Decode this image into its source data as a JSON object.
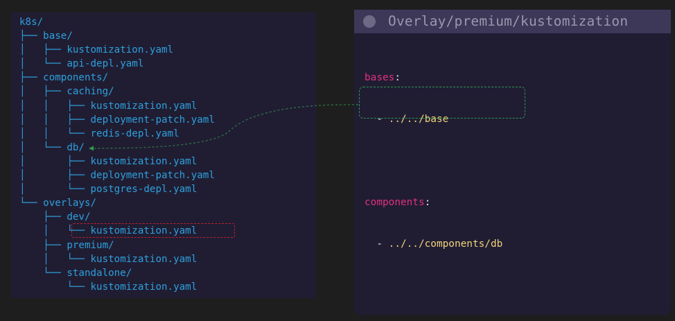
{
  "tree": {
    "rows": [
      {
        "prefix": "",
        "name": "k8s/"
      },
      {
        "prefix": "├── ",
        "name": "base/"
      },
      {
        "prefix": "│   ├── ",
        "name": "kustomization.yaml"
      },
      {
        "prefix": "│   └── ",
        "name": "api-depl.yaml"
      },
      {
        "prefix": "├── ",
        "name": "components/"
      },
      {
        "prefix": "│   ├── ",
        "name": "caching/"
      },
      {
        "prefix": "│   │   ├── ",
        "name": "kustomization.yaml"
      },
      {
        "prefix": "│   │   ├── ",
        "name": "deployment-patch.yaml"
      },
      {
        "prefix": "│   │   └── ",
        "name": "redis-depl.yaml"
      },
      {
        "prefix": "│   └── ",
        "name": "db/"
      },
      {
        "prefix": "│       ├── ",
        "name": "kustomization.yaml"
      },
      {
        "prefix": "│       ├── ",
        "name": "deployment-patch.yaml"
      },
      {
        "prefix": "│       └── ",
        "name": "postgres-depl.yaml"
      },
      {
        "prefix": "└── ",
        "name": "overlays/"
      },
      {
        "prefix": "    ├── ",
        "name": "dev/"
      },
      {
        "prefix": "    │   └── ",
        "name": "kustomization.yaml"
      },
      {
        "prefix": "    ├── ",
        "name": "premium/"
      },
      {
        "prefix": "    │   └── ",
        "name": "kustomization.yaml"
      },
      {
        "prefix": "    └── ",
        "name": "standalone/"
      },
      {
        "prefix": "        └── ",
        "name": "kustomization.yaml"
      }
    ]
  },
  "yaml_panel": {
    "title": "Overlay/premium/kustomization",
    "bases_key": "bases",
    "bases_item": "../../base",
    "components_key": "components",
    "components_item": "../../components/db",
    "colon": ":",
    "dash": "- "
  },
  "colors": {
    "tree_text": "#2ea0dc",
    "yaml_key": "#e3307a",
    "yaml_value": "#f2d37a",
    "highlight_red": "#c2202c",
    "highlight_green": "#2f9a4a",
    "panel_bg": "#201d33"
  }
}
